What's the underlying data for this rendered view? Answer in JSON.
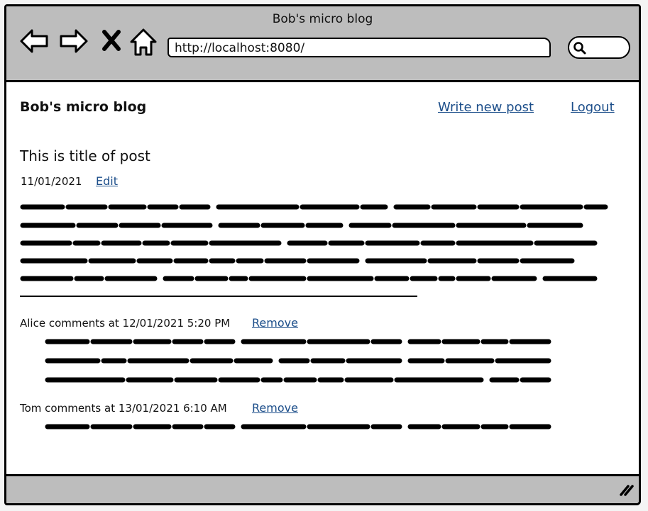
{
  "window": {
    "title": "Bob's micro blog"
  },
  "toolbar": {
    "back_icon": "back-arrow-icon",
    "forward_icon": "forward-arrow-icon",
    "stop_icon": "close-icon",
    "home_icon": "home-icon",
    "address": "http://localhost:8080/",
    "search_icon": "search-icon"
  },
  "header": {
    "brand": "Bob's micro blog",
    "write_link": "Write new post",
    "logout_link": "Logout"
  },
  "post": {
    "title": "This is title of post",
    "date": "11/01/2021",
    "edit_label": "Edit"
  },
  "comments": [
    {
      "heading": "Alice comments at 12/01/2021 5:20 PM",
      "remove_label": "Remove"
    },
    {
      "heading": "Tom comments at 13/01/2021 6:10 AM",
      "remove_label": "Remove"
    }
  ],
  "colors": {
    "chrome": "#bdbdbd",
    "link": "#1c4e8a",
    "ink": "#111111"
  }
}
